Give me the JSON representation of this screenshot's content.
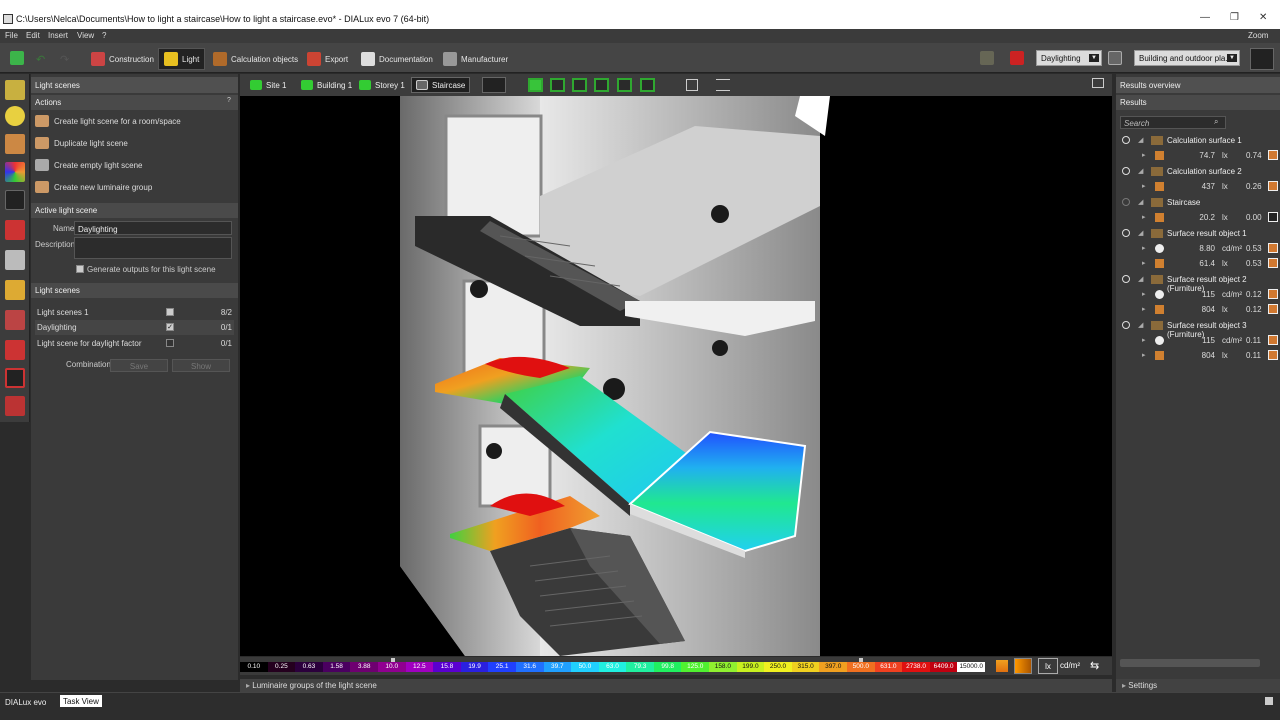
{
  "window": {
    "title": "C:\\Users\\Nelca\\Documents\\How to light a staircase\\How to light a staircase.evo* - DIALux evo 7  (64-bit)",
    "minimize": "—",
    "maximize": "❐",
    "close": "✕"
  },
  "menu": {
    "items": [
      "File",
      "Edit",
      "Insert",
      "View",
      "?"
    ],
    "zoom": "Zoom"
  },
  "toolbar": {
    "tabs": [
      "Construction",
      "Light",
      "Calculation objects",
      "Export",
      "Documentation",
      "Manufacturer"
    ],
    "active": "Light",
    "scene_select": "Daylighting",
    "view_select": "Building and outdoor pla..."
  },
  "left_panel": {
    "title": "Light scenes",
    "actions_header": "Actions",
    "actions": [
      "Create light scene for a room/space",
      "Duplicate light scene",
      "Create empty light scene",
      "Create new luminaire group"
    ],
    "active_header": "Active light scene",
    "name_label": "Name",
    "name_value": "Daylighting",
    "description_label": "Description",
    "generate_label": "Generate outputs for this light scene",
    "scenes_header": "Light scenes",
    "scenes": [
      {
        "name": "Light scenes 1",
        "count": "8/2",
        "checked": false
      },
      {
        "name": "Daylighting",
        "count": "0/1",
        "checked": true
      },
      {
        "name": "Light scene for daylight factor",
        "count": "0/1",
        "checked": false
      }
    ],
    "combination_label": "Combination",
    "save_label": "Save",
    "show_label": "Show"
  },
  "view_bar": {
    "breadcrumbs": [
      "Site 1",
      "Building 1",
      "Storey 1",
      "Staircase"
    ]
  },
  "scale": {
    "labels": [
      "0.10",
      "0.25",
      "0.63",
      "1.58",
      "3.88",
      "10.0",
      "12.5",
      "15.8",
      "19.9",
      "25.1",
      "31.6",
      "39.7",
      "50.0",
      "63.0",
      "79.3",
      "99.8",
      "125.0",
      "158.0",
      "199.0",
      "250.0",
      "315.0",
      "397.0",
      "500.0",
      "631.0",
      "2738.0",
      "6409.0",
      "15000.0"
    ],
    "colors": [
      "#000000",
      "#24001e",
      "#2b003c",
      "#4a0060",
      "#6e0070",
      "#900090",
      "#a000c0",
      "#5a00d0",
      "#2a20e0",
      "#2040ff",
      "#2070ff",
      "#20a0ff",
      "#20d0ff",
      "#20f0e0",
      "#20f0a0",
      "#20f060",
      "#50f030",
      "#90f030",
      "#c8f020",
      "#f0f020",
      "#f0d020",
      "#f0a020",
      "#f07020",
      "#f04020",
      "#e01010",
      "#c00010",
      "#ffffff"
    ],
    "unit_lx": "lx",
    "unit_cd": "cd/m²"
  },
  "lum_groups": "Luminaire groups of the light scene",
  "right_panel": {
    "title": "Results overview",
    "results_header": "Results",
    "search_placeholder": "Search",
    "groups": [
      {
        "name": "Calculation surface 1",
        "rows": [
          {
            "val": "74.7",
            "unit": "lx",
            "ratio": "0.74"
          }
        ]
      },
      {
        "name": "Calculation surface 2",
        "rows": [
          {
            "val": "437",
            "unit": "lx",
            "ratio": "0.26"
          }
        ]
      },
      {
        "name": "Staircase",
        "rows": [
          {
            "val": "20.2",
            "unit": "lx",
            "ratio": "0.00"
          }
        ]
      },
      {
        "name": "Surface result object 1",
        "rows": [
          {
            "val": "8.80",
            "unit": "cd/m²",
            "ratio": "0.53"
          },
          {
            "val": "61.4",
            "unit": "lx",
            "ratio": "0.53"
          }
        ]
      },
      {
        "name": "Surface result object 2 (Furniture)",
        "rows": [
          {
            "val": "115",
            "unit": "cd/m²",
            "ratio": "0.12"
          },
          {
            "val": "804",
            "unit": "lx",
            "ratio": "0.12"
          }
        ]
      },
      {
        "name": "Surface result object 3 (Furniture)",
        "rows": [
          {
            "val": "115",
            "unit": "cd/m²",
            "ratio": "0.11"
          },
          {
            "val": "804",
            "unit": "lx",
            "ratio": "0.11"
          }
        ]
      }
    ],
    "settings": "Settings"
  },
  "taskbar": {
    "app": "DIALux evo",
    "taskview": "Task View"
  }
}
